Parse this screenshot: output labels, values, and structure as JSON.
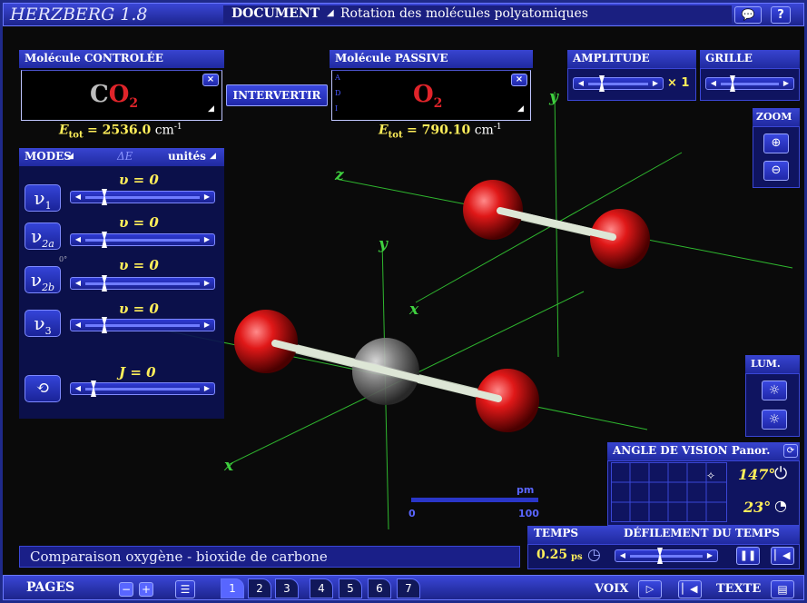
{
  "app": {
    "title": "HERZBERG 1.8",
    "document_label": "DOCUMENT",
    "document_title": "Rotation des molécules polyatomiques"
  },
  "controlled": {
    "header": "Molécule CONTROLÉE",
    "formula_c": "C",
    "formula_o": "O",
    "formula_sub": "2",
    "energy_label": "E",
    "energy_sub": "tot",
    "energy_value": "= 2536.0",
    "energy_unit": "cm",
    "energy_exp": "-1"
  },
  "passive": {
    "header": "Molécule PASSIVE",
    "letters": [
      "A",
      "D",
      "I"
    ],
    "formula_o": "O",
    "formula_sub": "2",
    "energy_label": "E",
    "energy_sub": "tot",
    "energy_value": "= 790.10",
    "energy_unit": "cm",
    "energy_exp": "-1"
  },
  "swap_button": "INTERVERTIR",
  "amplitude": {
    "header": "AMPLITUDE",
    "multiplier": "× 1"
  },
  "grid": {
    "header": "GRILLE"
  },
  "zoom": {
    "header": "ZOOM"
  },
  "lum": {
    "header": "LUM."
  },
  "modes": {
    "header": "MODES",
    "delta": "ΔE",
    "units": "unités",
    "items": [
      {
        "symbol": "ν",
        "sub": "1",
        "value": "υ = 0"
      },
      {
        "symbol": "ν",
        "sub": "2a",
        "value": "υ = 0"
      },
      {
        "symbol": "ν",
        "sub": "2b",
        "value": "υ = 0"
      },
      {
        "symbol": "ν",
        "sub": "3",
        "value": "υ = 0"
      }
    ],
    "rotation_value": "J = 0",
    "degree": "0°"
  },
  "axes": {
    "x": "x",
    "y": "y",
    "z": "z"
  },
  "scale": {
    "unit": "pm",
    "min": "0",
    "max": "100"
  },
  "view_angle": {
    "header": "ANGLE DE VISION",
    "panor": "Panor.",
    "angle1": "147°",
    "angle2": "23°"
  },
  "time": {
    "header": "TEMPS",
    "scroll_header": "DÉFILEMENT DU TEMPS",
    "value": "0.25",
    "unit": "ps"
  },
  "caption": "Comparaison oxygène - bioxide de carbone",
  "pages": {
    "label": "PAGES",
    "numbers": [
      "1",
      "2",
      "3",
      "4",
      "5",
      "6",
      "7"
    ],
    "active": "1"
  },
  "footer": {
    "voice": "VOIX",
    "text": "TEXTE"
  },
  "colors": {
    "accent": "#2b36c8",
    "yellow": "#ffef5a",
    "red": "#e0242a",
    "axis": "#2fc02f"
  }
}
